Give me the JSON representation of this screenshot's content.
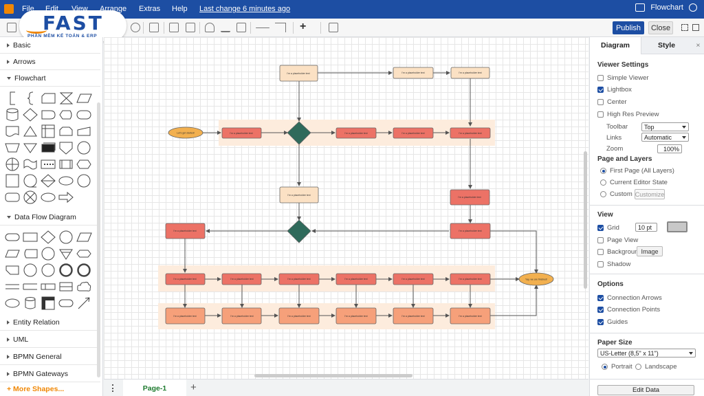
{
  "menubar": {
    "items": [
      "File",
      "Edit",
      "View",
      "Arrange",
      "Extras",
      "Help"
    ],
    "last_change": "Last change 6 minutes ago",
    "app_title": "Flowchart"
  },
  "logo": {
    "word": "FAST",
    "subtitle": "PHẦN MỀM KẾ TOÁN & ERP",
    "brand_color": "#1d4ea3",
    "accent_color": "#f08705"
  },
  "toolbar": {
    "publish_label": "Publish",
    "close_label": "Close"
  },
  "sidebar": {
    "sections": [
      "Basic",
      "Arrows",
      "Flowchart",
      "Data Flow Diagram",
      "Entity Relation",
      "UML",
      "BPMN General",
      "BPMN Gateways"
    ],
    "more_shapes": "+ More Shapes..."
  },
  "pagebar": {
    "page_tab": "Page-1",
    "add_label": "+"
  },
  "panel": {
    "tab_diagram": "Diagram",
    "tab_style": "Style",
    "tab_close": "×",
    "viewer_settings": {
      "title": "Viewer Settings",
      "simple_viewer": "Simple Viewer",
      "lightbox": "Lightbox",
      "center": "Center",
      "high_res": "High Res Preview",
      "toolbar_label": "Toolbar",
      "toolbar_value": "Top",
      "links_label": "Links",
      "links_value": "Automatic",
      "zoom_label": "Zoom",
      "zoom_value": "100%"
    },
    "page_layers": {
      "title": "Page and Layers",
      "first_page": "First Page (All Layers)",
      "current_editor": "Current Editor State",
      "custom": "Custom",
      "customize": "Customize"
    },
    "view": {
      "title": "View",
      "grid": "Grid",
      "grid_size": "10 pt",
      "page_view": "Page View",
      "background": "Background",
      "image_button": "Image",
      "shadow": "Shadow"
    },
    "options": {
      "title": "Options",
      "connection_arrows": "Connection Arrows",
      "connection_points": "Connection Points",
      "guides": "Guides"
    },
    "paper": {
      "title": "Paper Size",
      "size_value": "US-Letter (8,5\" x 11\")",
      "portrait": "Portrait",
      "landscape": "Landscape"
    },
    "edit_data": "Edit Data"
  },
  "diagram": {
    "placeholder": "I'm a placeholder text",
    "start_label": "Let's get started!",
    "end_label": "Yay, we are finished!",
    "colors": {
      "light_box": "#fbe1c4",
      "red_box": "#ec7266",
      "orange_box": "#f6a07a",
      "diamond": "#2f6a5b",
      "ellipse": "#f2b04f",
      "band": "#fdecdd"
    }
  }
}
